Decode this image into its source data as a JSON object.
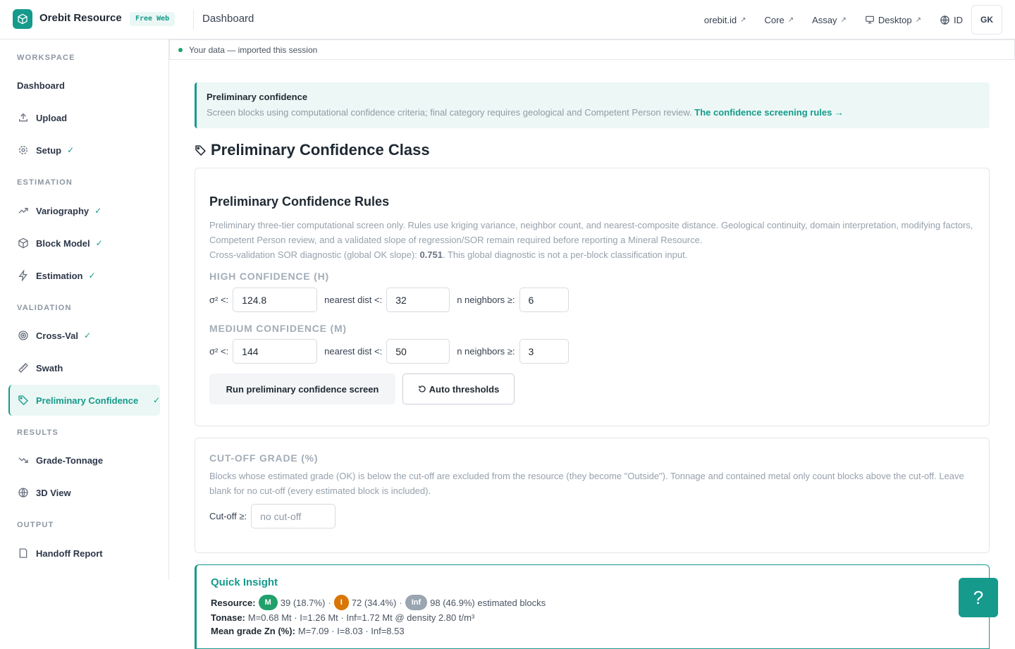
{
  "header": {
    "brand": "Orebit Resource",
    "tier": "Free Web",
    "breadcrumb": "Dashboard",
    "links": [
      {
        "label": "orebit.id",
        "icon": "external-link-icon"
      },
      {
        "label": "Core",
        "icon": "external-link-icon"
      },
      {
        "label": "Assay",
        "icon": "external-link-icon"
      },
      {
        "label": "Desktop",
        "icon": "monitor-icon"
      },
      {
        "label": "ID",
        "icon": "globe-icon"
      }
    ],
    "avatar": "GK"
  },
  "sidebar": {
    "sections": [
      "WORKSPACE",
      "ESTIMATION",
      "VALIDATION",
      "RESULTS",
      "OUTPUT"
    ],
    "items": [
      {
        "label": "Dashboard",
        "check": ""
      },
      {
        "label": "Upload",
        "check": ""
      },
      {
        "label": "Setup",
        "check": "✓"
      },
      {
        "label": "Variography",
        "check": "✓"
      },
      {
        "label": "Block Model",
        "check": "✓"
      },
      {
        "label": "Estimation",
        "check": "✓"
      },
      {
        "label": "Cross-Val",
        "check": "✓"
      },
      {
        "label": "Swath",
        "check": ""
      },
      {
        "label": "Preliminary Confidence",
        "check": "✓"
      },
      {
        "label": "Grade-Tonnage",
        "check": ""
      },
      {
        "label": "3D View",
        "check": ""
      },
      {
        "label": "Handoff Report",
        "check": ""
      }
    ]
  },
  "status": "Your data — imported this session",
  "banner": {
    "title": "Preliminary confidence",
    "text": "Screen blocks using computational confidence criteria; final category requires geological and Competent Person review.",
    "link": "The confidence screening rules →"
  },
  "page_title": "Preliminary Confidence Class",
  "rules": {
    "title": "Preliminary Confidence Rules",
    "desc": "Preliminary three-tier computational screen only. Rules use kriging variance, neighbor count, and nearest-composite distance. Geological continuity, domain interpretation, modifying factors, Competent Person review, and a validated slope of regression/SOR remain required before reporting a Mineral Resource.",
    "desc2_prefix": "Cross-validation SOR diagnostic (global OK slope):",
    "sor_value": "0.751",
    "desc2_suffix": ". This global diagnostic is not a per-block classification input.",
    "high": {
      "label": "HIGH CONFIDENCE (H)",
      "sigma_label": "σ² <:",
      "sigma": "124.8",
      "dist_label": "nearest dist <:",
      "dist": "32",
      "n_label": "n neighbors ≥:",
      "n": "6"
    },
    "medium": {
      "label": "MEDIUM CONFIDENCE (M)",
      "sigma_label": "σ² <:",
      "sigma": "144",
      "dist_label": "nearest dist <:",
      "dist": "50",
      "n_label": "n neighbors ≥:",
      "n": "3"
    },
    "run_button": "Run preliminary confidence screen",
    "auto_button": "Auto thresholds"
  },
  "cutoff": {
    "title": "CUT-OFF GRADE (%)",
    "desc": "Blocks whose estimated grade (OK) is below the cut-off are excluded from the resource (they become \"Outside\"). Tonnage and contained metal only count blocks above the cut-off. Leave blank for no cut-off (every estimated block is included).",
    "label": "Cut-off ≥:",
    "placeholder": "no cut-off"
  },
  "insight": {
    "title": "Quick Insight",
    "resource_label": "Resource:",
    "m_badge": "M",
    "m_text": "39 (18.7%)",
    "i_badge": "I",
    "i_text": "72 (34.4%)",
    "inf_badge": "Inf",
    "inf_text": "98 (46.9%) estimated blocks",
    "tonase_label": "Tonase:",
    "tonase_text": "M=0.68 Mt · I=1.26 Mt · Inf=1.72 Mt @ density 2.80 t/m³",
    "grade_label": "Mean grade Zn (%):",
    "grade_text": "M=7.09 · I=8.03 · Inf=8.53"
  },
  "help": "?",
  "colors": {
    "accent": "#159a8c",
    "measured": "#22a06b",
    "indicated": "#d97706",
    "inferred": "#9aa5b1"
  }
}
